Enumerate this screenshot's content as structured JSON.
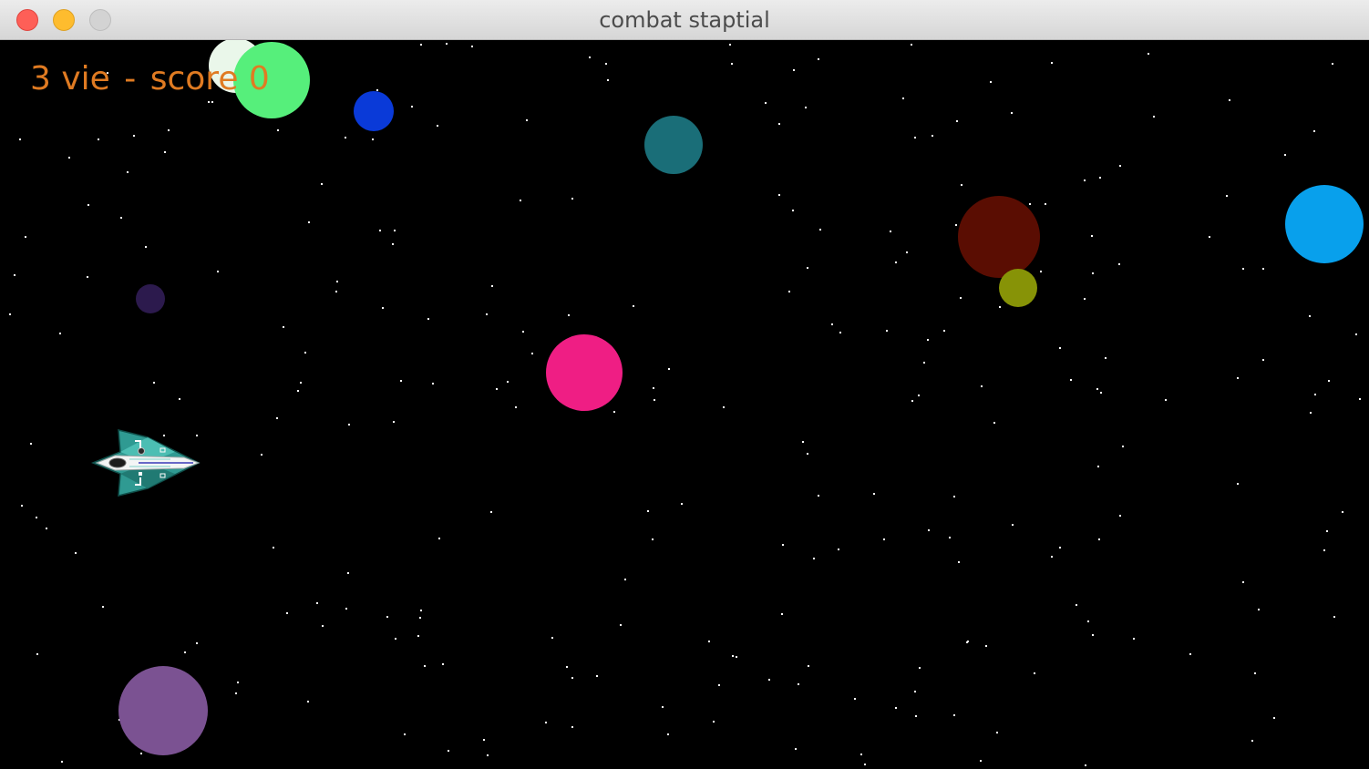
{
  "window": {
    "title": "combat staptial"
  },
  "hud": {
    "lives": "3",
    "lives_label": "vie",
    "separator": "-",
    "score_label": "score",
    "score": "0"
  },
  "colors": {
    "background": "#000000",
    "hud_text": "#e07b22",
    "star": "#ffffff"
  },
  "planets": [
    {
      "name": "planet-pale-green",
      "color": "#eaf7ea"
    },
    {
      "name": "planet-green",
      "color": "#56ef7b"
    },
    {
      "name": "planet-blue",
      "color": "#0a3ad8"
    },
    {
      "name": "planet-teal",
      "color": "#1a6e78"
    },
    {
      "name": "planet-dark-red",
      "color": "#5a0d02"
    },
    {
      "name": "planet-olive",
      "color": "#879307"
    },
    {
      "name": "planet-sky-blue",
      "color": "#08a0ec"
    },
    {
      "name": "planet-dark-purple",
      "color": "#2c1a4d"
    },
    {
      "name": "planet-pink",
      "color": "#ef1e84"
    },
    {
      "name": "planet-purple",
      "color": "#7b5292"
    }
  ],
  "player": {
    "icon": "spaceship-icon"
  }
}
